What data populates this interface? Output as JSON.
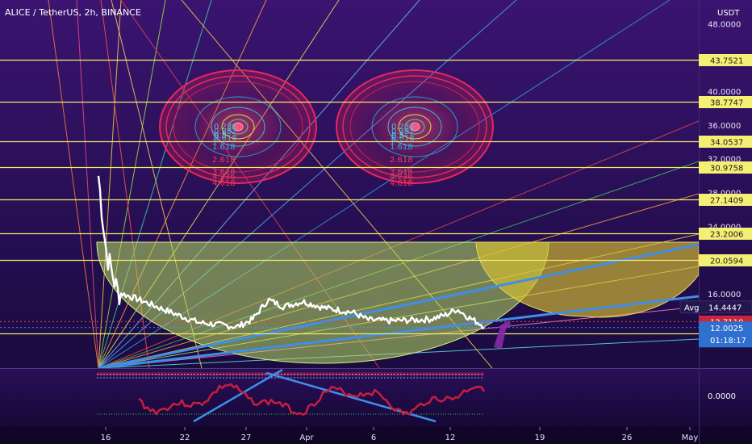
{
  "header": {
    "title": "ALICE / TetherUS, 2h, BINANCE",
    "currency": "USDT"
  },
  "colors": {
    "bg_top": "#3a1470",
    "bg_bottom": "#1a0b40",
    "hline": "#f2ec6a",
    "price_line": "#ffffff",
    "trend": "#3f8ee8",
    "current_label": "#2f6fce",
    "last_label": "#c9253d",
    "indicator": "#c81e3e"
  },
  "chart_data": {
    "type": "line",
    "symbol": "ALICE / TetherUS",
    "interval": "2h",
    "exchange": "BINANCE",
    "y_axis": {
      "unit": "USDT",
      "range": [
        10.0,
        49.0
      ],
      "ticks": [
        {
          "value": "16.0000",
          "v": 16.0
        },
        {
          "value": "24.0000",
          "v": 24.0
        },
        {
          "value": "28.0000",
          "v": 28.0
        },
        {
          "value": "32.0000",
          "v": 32.0
        },
        {
          "value": "36.0000",
          "v": 36.0
        },
        {
          "value": "40.0000",
          "v": 40.0
        },
        {
          "value": "48.0000",
          "v": 48.0
        }
      ]
    },
    "x_axis": {
      "ticks": [
        "16",
        "22",
        "27",
        "Apr",
        "6",
        "12",
        "19",
        "26",
        "May"
      ]
    },
    "horizontal_levels": [
      {
        "label": "43.7521",
        "v": 43.7521
      },
      {
        "label": "38.7747",
        "v": 38.7747
      },
      {
        "label": "34.0537",
        "v": 34.0537
      },
      {
        "label": "30.9758",
        "v": 30.9758
      },
      {
        "label": "27.1409",
        "v": 27.1409
      },
      {
        "label": "23.2006",
        "v": 23.2006
      },
      {
        "label": "20.0594",
        "v": 20.0594
      },
      {
        "label": "11.3061",
        "v": 11.3061
      }
    ],
    "price_labels": {
      "avg_label": "Avg",
      "avg_value": "14.4447",
      "avg_v": 14.4447,
      "last_value": "12.7110",
      "last_v": 12.711,
      "current_value": "12.0025",
      "current_v": 12.0025,
      "countdown": "01:18:17"
    },
    "fib_labels": [
      "0.236",
      "0.382",
      "0.5",
      "0.618",
      "1",
      "1.618",
      "2.618",
      "3.618",
      "4.236",
      "4.618"
    ],
    "price_series_approx": [
      [
        0.0,
        30.0
      ],
      [
        0.02,
        21.0
      ],
      [
        0.05,
        16.2
      ],
      [
        0.1,
        15.4
      ],
      [
        0.15,
        14.5
      ],
      [
        0.2,
        13.6
      ],
      [
        0.26,
        12.6
      ],
      [
        0.32,
        12.3
      ],
      [
        0.36,
        12.1
      ],
      [
        0.4,
        13.0
      ],
      [
        0.44,
        15.3
      ],
      [
        0.48,
        14.5
      ],
      [
        0.53,
        15.1
      ],
      [
        0.58,
        14.4
      ],
      [
        0.62,
        14.1
      ],
      [
        0.66,
        13.8
      ],
      [
        0.7,
        12.9
      ],
      [
        0.76,
        12.8
      ],
      [
        0.82,
        12.9
      ],
      [
        0.86,
        13.0
      ],
      [
        0.9,
        13.5
      ],
      [
        0.93,
        14.2
      ],
      [
        0.96,
        13.2
      ],
      [
        1.0,
        12.2
      ]
    ]
  },
  "indicator": {
    "zero_label": "0.0000",
    "v": 0.0
  }
}
